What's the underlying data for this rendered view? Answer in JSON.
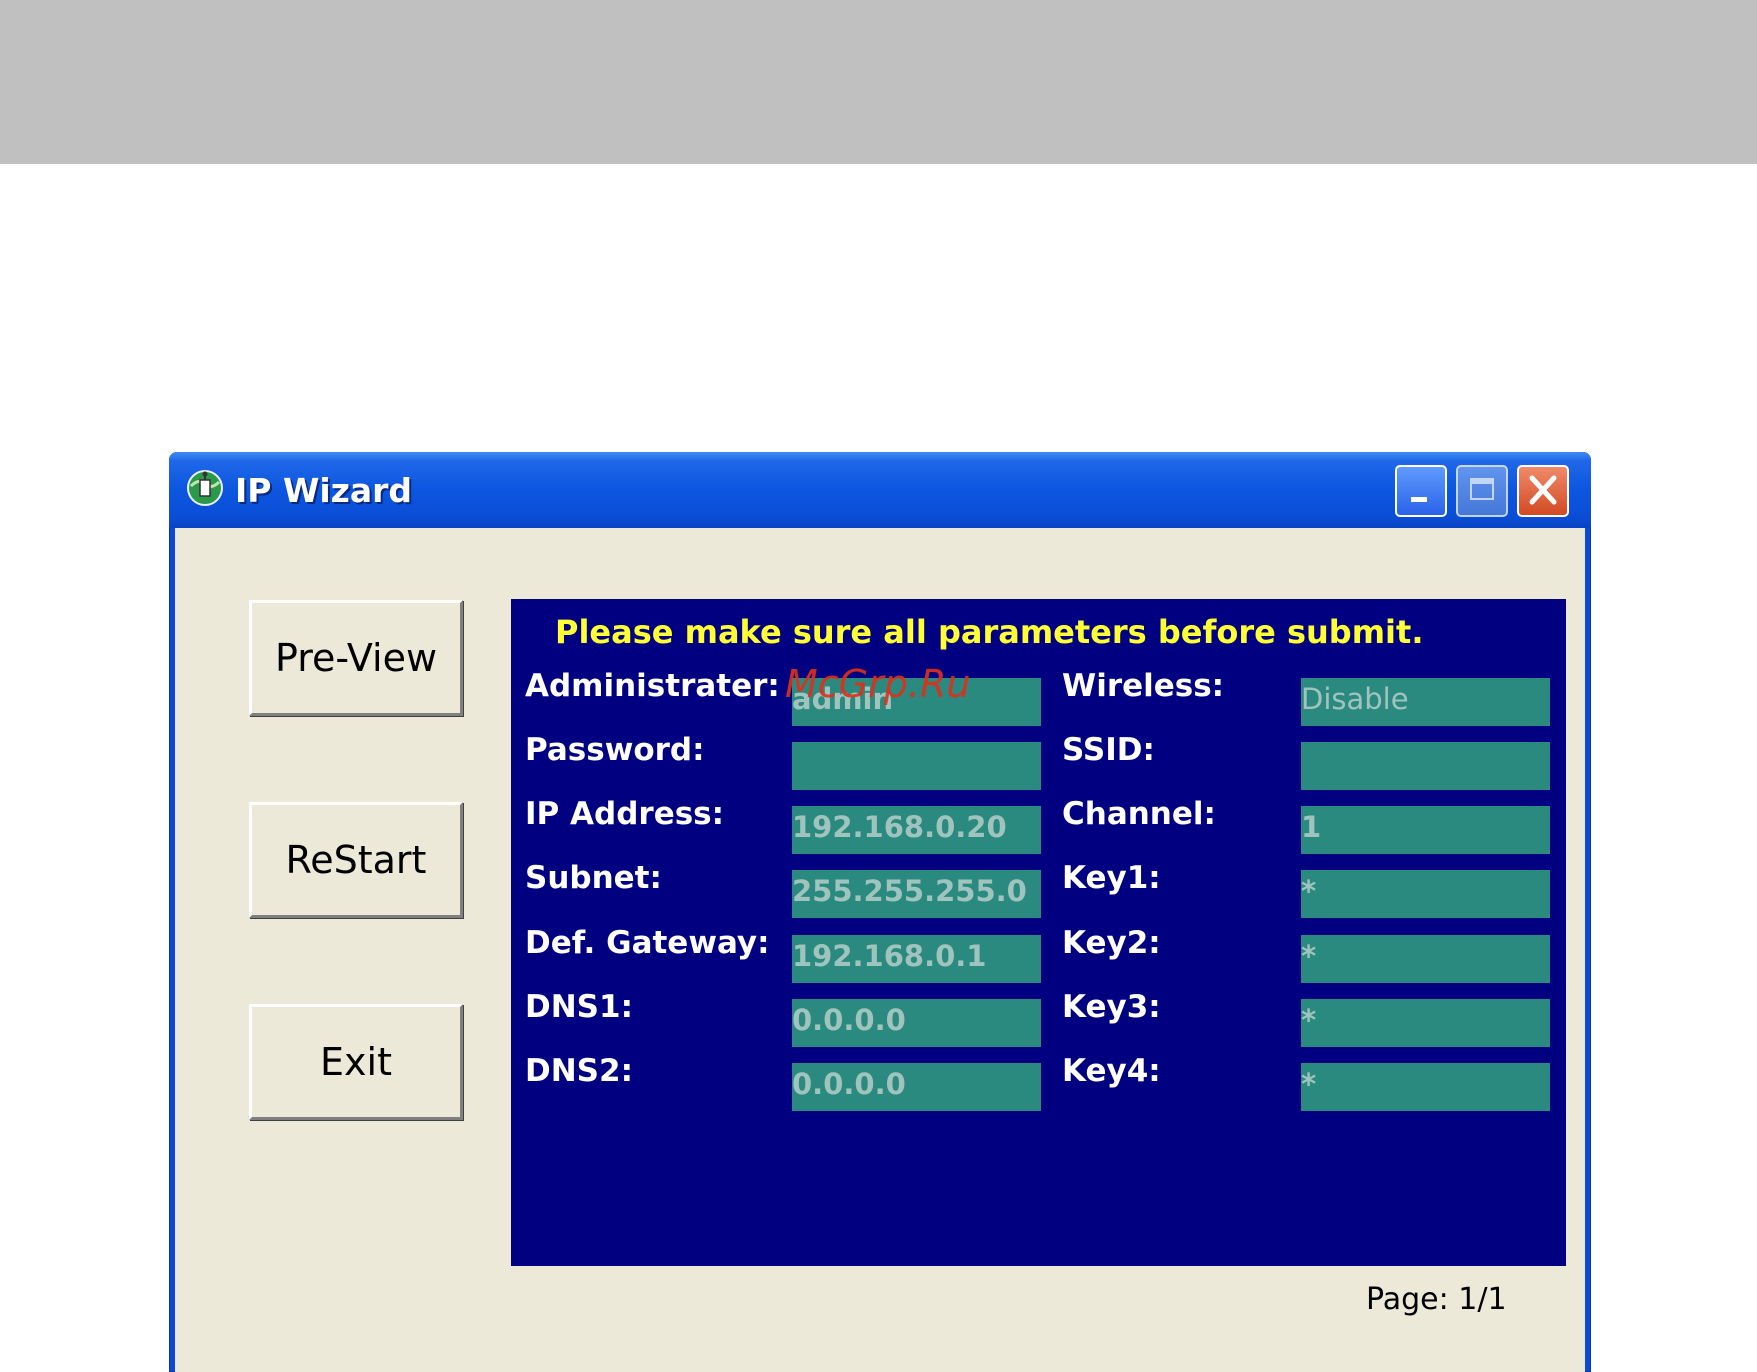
{
  "window": {
    "title": "IP Wizard"
  },
  "side_buttons": {
    "preview_label": "Pre-View",
    "restart_label": "ReStart",
    "exit_label": "Exit"
  },
  "panel": {
    "notice": "Please make sure all parameters before submit.",
    "left_fields": [
      {
        "label": "Administrater:",
        "value": "admin"
      },
      {
        "label": "Password:",
        "value": ""
      },
      {
        "label": "IP Address:",
        "value": "192.168.0.20"
      },
      {
        "label": "Subnet:",
        "value": "255.255.255.0"
      },
      {
        "label": "Def. Gateway:",
        "value": "192.168.0.1"
      },
      {
        "label": "DNS1:",
        "value": "0.0.0.0"
      },
      {
        "label": "DNS2:",
        "value": "0.0.0.0"
      }
    ],
    "right_fields": [
      {
        "label": "Wireless:",
        "value": "Disable"
      },
      {
        "label": "SSID:",
        "value": ""
      },
      {
        "label": "Channel:",
        "value": "1"
      },
      {
        "label": "Key1:",
        "value": "*"
      },
      {
        "label": "Key2:",
        "value": "*"
      },
      {
        "label": "Key3:",
        "value": "*"
      },
      {
        "label": "Key4:",
        "value": "*"
      }
    ]
  },
  "page_indicator": "Page: 1/1",
  "watermark": "McGrp.Ru",
  "colors": {
    "panel_bg": "#000080",
    "notice_text": "#ffff33",
    "field_bg": "#2b8a80",
    "field_text": "#9fc4bd",
    "titlebar": "#0a4ed6",
    "client_bg": "#ece9d8"
  },
  "icons": {
    "app": "network-wizard-icon",
    "minimize": "minimize-icon",
    "maximize": "maximize-icon",
    "close": "close-icon"
  }
}
